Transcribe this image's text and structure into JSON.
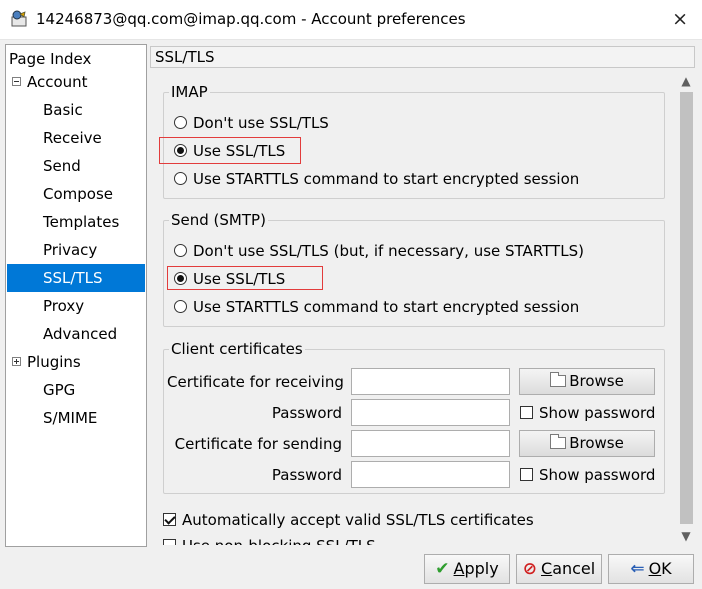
{
  "window": {
    "title": "14246873@qq.com@imap.qq.com - Account preferences",
    "close_icon": "×"
  },
  "sidebar": {
    "header": "Page Index",
    "items": [
      {
        "label": "Account",
        "toggle": "minus"
      },
      {
        "label": "Basic"
      },
      {
        "label": "Receive"
      },
      {
        "label": "Send"
      },
      {
        "label": "Compose"
      },
      {
        "label": "Templates"
      },
      {
        "label": "Privacy"
      },
      {
        "label": "SSL/TLS",
        "selected": true
      },
      {
        "label": "Proxy"
      },
      {
        "label": "Advanced"
      },
      {
        "label": "Plugins",
        "toggle": "plus"
      },
      {
        "label": "GPG"
      },
      {
        "label": "S/MIME"
      }
    ]
  },
  "page": {
    "header": "SSL/TLS"
  },
  "imap": {
    "title": "IMAP",
    "options": [
      {
        "label": "Don't use SSL/TLS",
        "checked": false
      },
      {
        "label": "Use SSL/TLS",
        "checked": true
      },
      {
        "label": "Use STARTTLS command to start encrypted session",
        "checked": false
      }
    ]
  },
  "send": {
    "title": "Send (SMTP)",
    "options": [
      {
        "label": "Don't use SSL/TLS (but, if necessary, use STARTTLS)",
        "checked": false
      },
      {
        "label": "Use SSL/TLS",
        "checked": true
      },
      {
        "label": "Use STARTTLS command to start encrypted session",
        "checked": false
      }
    ]
  },
  "certs": {
    "title": "Client certificates",
    "receive_label": "Certificate for receiving",
    "receive_value": "",
    "password_label": "Password",
    "receive_password_value": "",
    "send_label": "Certificate for sending",
    "send_value": "",
    "send_password_value": "",
    "browse_label": "Browse",
    "show_password_label": "Show password"
  },
  "options": {
    "auto_accept_label": "Automatically accept valid SSL/TLS certificates",
    "auto_accept_checked": true,
    "partial_label": "Use non-blocking SSL/TLS"
  },
  "buttons": {
    "apply_accel": "A",
    "apply_rest": "pply",
    "cancel_accel": "C",
    "cancel_rest": "ancel",
    "ok_accel": "O",
    "ok_rest": "K"
  },
  "colors": {
    "selection": "#0078d7",
    "highlight": "#e23c3c"
  }
}
